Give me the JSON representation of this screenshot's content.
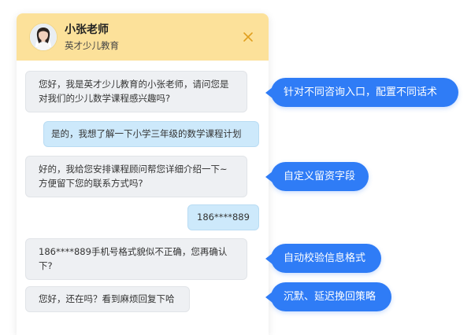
{
  "header": {
    "agent_name": "小张老师",
    "organization": "英才少儿教育"
  },
  "messages": [
    {
      "role": "agent",
      "lines": [
        "您好，我是英才少儿教育的小张老师，请问您是",
        "对我们的少儿数学课程感兴趣吗?"
      ]
    },
    {
      "role": "user",
      "lines": [
        "是的，我想了解一下小学三年级的数学课程计划"
      ]
    },
    {
      "role": "agent",
      "lines": [
        "好的，我给您安排课程顾问帮您详细介绍一下~",
        "方便留下您的联系方式吗?"
      ]
    },
    {
      "role": "user",
      "lines": [
        "186****889"
      ]
    },
    {
      "role": "agent",
      "lines": [
        "186****889手机号格式貌似不正确，您再确认",
        "下?"
      ]
    },
    {
      "role": "agent",
      "lines": [
        "您好，还在吗？看到麻烦回复下哈"
      ]
    }
  ],
  "callouts": [
    "针对不同咨询入口，配置不同话术",
    "自定义留资字段",
    "自动校验信息格式",
    "沉默、延迟挽回策略"
  ],
  "colors": {
    "header_bg": "#fce19a",
    "agent_bubble": "#eef0f3",
    "user_bubble": "#cde9fb",
    "callout_bg": "#2f7cf6",
    "close_icon": "#e0a020"
  },
  "icons": {
    "close": "close-icon",
    "avatar": "teacher-avatar"
  }
}
